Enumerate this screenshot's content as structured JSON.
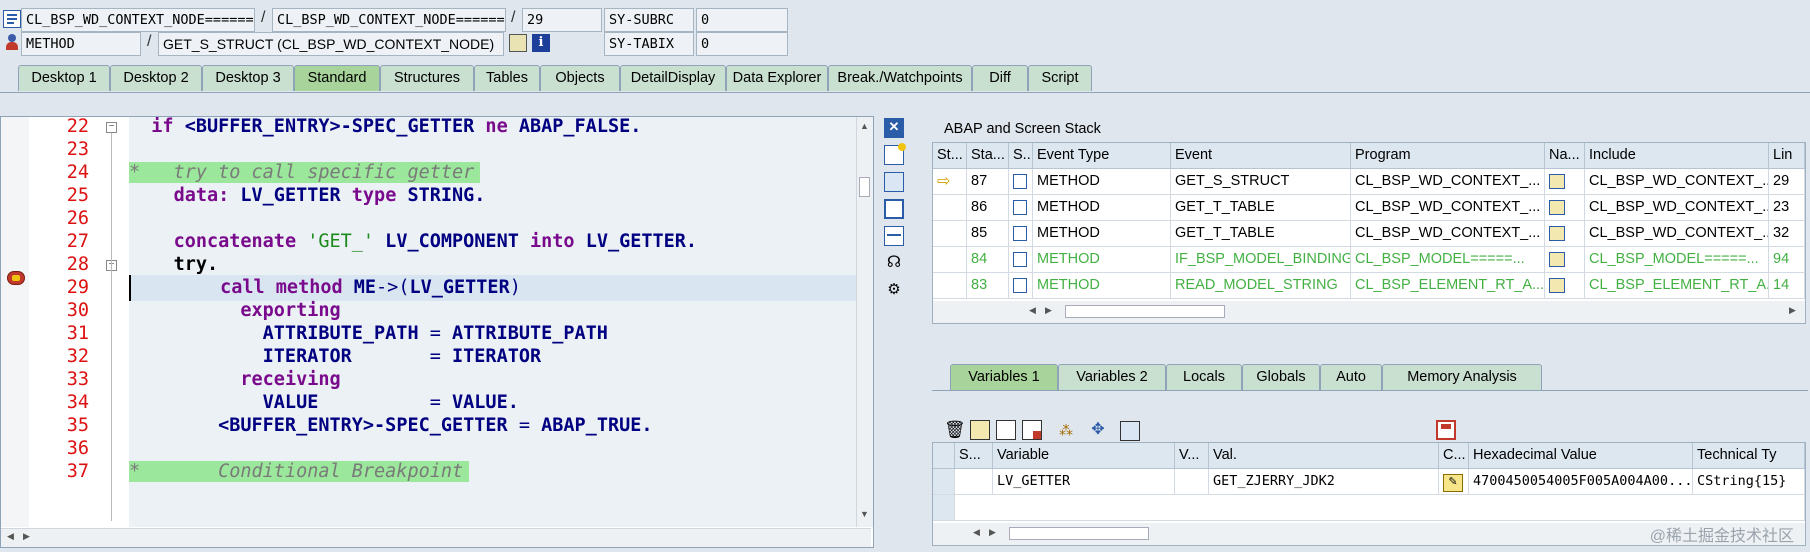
{
  "top": {
    "row1": {
      "class_field": "CL_BSP_WD_CONTEXT_NODE========",
      "class_field2": "CL_BSP_WD_CONTEXT_NODE========",
      "line": "29",
      "sysvar": "SY-SUBRC",
      "sysval": "0"
    },
    "row2": {
      "type_field": "METHOD",
      "event_field": "GET_S_STRUCT (CL_BSP_WD_CONTEXT_NODE)",
      "sysvar": "SY-TABIX",
      "sysval": "0"
    },
    "sep": "/"
  },
  "tabs": [
    "Desktop 1",
    "Desktop 2",
    "Desktop 3",
    "Standard",
    "Structures",
    "Tables",
    "Objects",
    "DetailDisplay",
    "Data Explorer",
    "Break./Watchpoints",
    "Diff",
    "Script"
  ],
  "code": {
    "line_numbers": [
      "22",
      "23",
      "24",
      "25",
      "26",
      "27",
      "28",
      "29",
      "30",
      "31",
      "32",
      "33",
      "34",
      "35",
      "36",
      "37"
    ],
    "l22": {
      "a": "if ",
      "b": "<BUFFER_ENTRY>-SPEC_GETTER",
      "c": " ne ",
      "d": "ABAP_FALSE."
    },
    "l24": "*   try to call specific getter",
    "l25": {
      "a": "data: ",
      "b": "LV_GETTER ",
      "c": "type ",
      "d": "STRING."
    },
    "l27": {
      "a": "concatenate ",
      "b": "'GET_'",
      "c": " LV_COMPONENT ",
      "d": "into ",
      "e": "LV_GETTER."
    },
    "l28": "try.",
    "l29": {
      "a": "call method ",
      "b": "ME",
      "c": "->(",
      "d": "LV_GETTER",
      "e": ")"
    },
    "l30": "exporting",
    "l31": {
      "a": "ATTRIBUTE_PATH ",
      "b": "= ",
      "c": "ATTRIBUTE_PATH"
    },
    "l32": {
      "a": "ITERATOR       ",
      "b": "= ",
      "c": "ITERATOR"
    },
    "l33": "receiving",
    "l34": {
      "a": "VALUE          ",
      "b": "= ",
      "c": "VALUE."
    },
    "l35": {
      "a": "<BUFFER_ENTRY>-SPEC_GETTER ",
      "b": "= ",
      "c": "ABAP_TRUE."
    },
    "l37": "*       Conditional Breakpoint"
  },
  "stack": {
    "title": "ABAP and Screen Stack",
    "headers": [
      "St...",
      "Sta...",
      "S...",
      "Event Type",
      "Event",
      "Program",
      "Na...",
      "Include",
      "Lin"
    ],
    "rows": [
      {
        "level": "87",
        "type": "METHOD",
        "event": "GET_S_STRUCT",
        "program": "CL_BSP_WD_CONTEXT_...",
        "include": "CL_BSP_WD_CONTEXT_...",
        "line": "29"
      },
      {
        "level": "86",
        "type": "METHOD",
        "event": "GET_T_TABLE",
        "program": "CL_BSP_WD_CONTEXT_...",
        "include": "CL_BSP_WD_CONTEXT_...",
        "line": "23"
      },
      {
        "level": "85",
        "type": "METHOD",
        "event": "GET_T_TABLE",
        "program": "CL_BSP_WD_CONTEXT_...",
        "include": "CL_BSP_WD_CONTEXT_...",
        "line": "32"
      },
      {
        "level": "84",
        "type": "METHOD",
        "event": "IF_BSP_MODEL_BINDING...",
        "program": "CL_BSP_MODEL=====...",
        "include": "CL_BSP_MODEL=====...",
        "line": "94"
      },
      {
        "level": "83",
        "type": "METHOD",
        "event": "READ_MODEL_STRING",
        "program": "CL_BSP_ELEMENT_RT_A...",
        "include": "CL_BSP_ELEMENT_RT_A...",
        "line": "14"
      }
    ]
  },
  "vartabs": [
    "Variables 1",
    "Variables 2",
    "Locals",
    "Globals",
    "Auto",
    "Memory Analysis"
  ],
  "vars": {
    "headers": [
      "S...",
      "Variable",
      "V...",
      "Val.",
      "C...",
      "Hexadecimal Value",
      "Technical Ty"
    ],
    "row": {
      "variable": "LV_GETTER",
      "value": "GET_ZJERRY_JDK2",
      "hex": "4700450054005F005A004A00...",
      "type": "CString{15}"
    }
  },
  "watermark": "@稀土掘金技术社区",
  "colors": {
    "accent_green": "#a8d39a",
    "comment_bg": "#9be79b",
    "line_number": "#dd1111",
    "keyword": "#7a0a8c"
  }
}
